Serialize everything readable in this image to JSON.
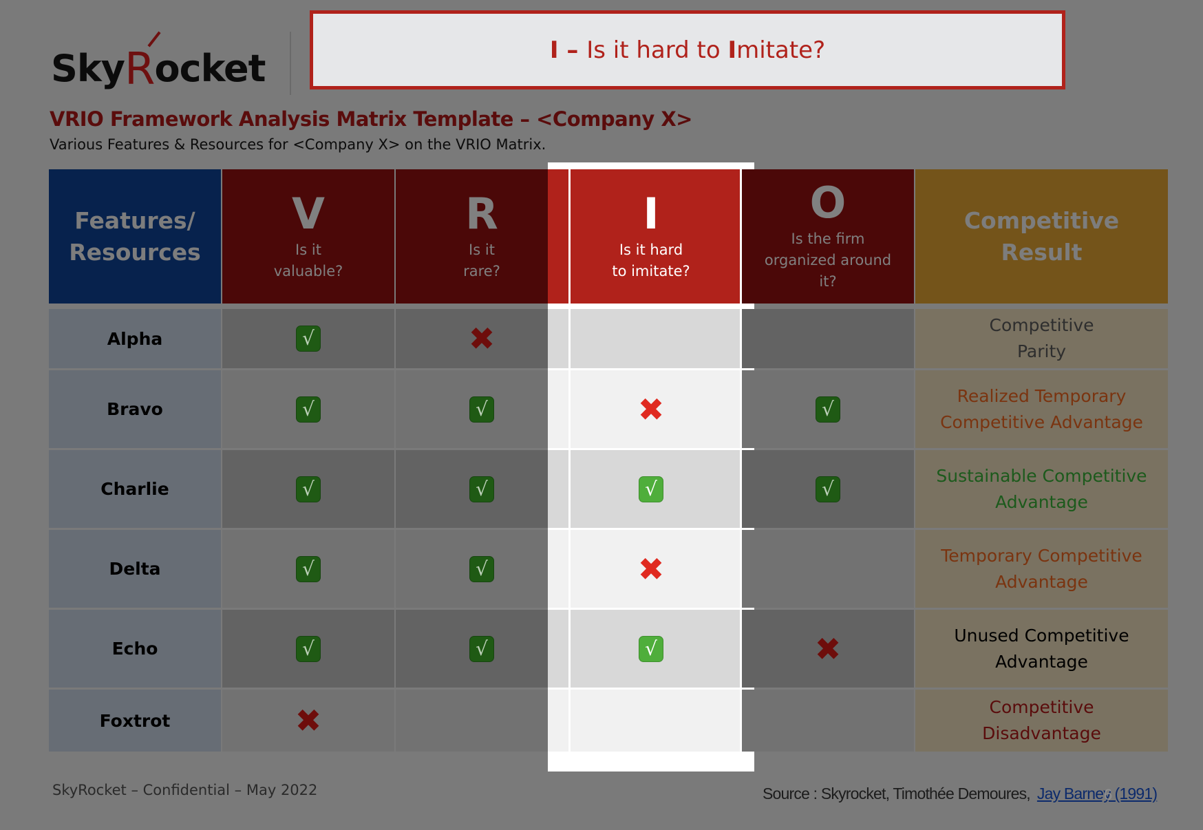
{
  "logo": {
    "prefix": "Sky",
    "accent": "R",
    "suffix": "ocket"
  },
  "title_box": {
    "letter": "I",
    "dash": " – ",
    "pre": "Is it hard to ",
    "accent": "I",
    "post": "mitate?"
  },
  "heading": "VRIO Framework Analysis Matrix Template – <Company X>",
  "subheading": "Various Features & Resources for <Company X> on the VRIO Matrix.",
  "colors": {
    "accent_red": "#b0221b",
    "dark_red": "#4b0808",
    "navy": "#07224d",
    "gold": "#74541a",
    "check_green": "#1f5a14",
    "check_green_bright": "#4fae3b",
    "cross_red": "#6e0d0b",
    "cross_red_bright": "#e02a20"
  },
  "table": {
    "header": {
      "features_line1": "Features/",
      "features_line2": "Resources",
      "columns": [
        {
          "letter": "V",
          "q1": "Is it",
          "q2": "valuable?",
          "q3": ""
        },
        {
          "letter": "R",
          "q1": "Is it",
          "q2": "rare?",
          "q3": ""
        },
        {
          "letter": "I",
          "q1": "Is it hard",
          "q2": "to imitate?",
          "q3": ""
        },
        {
          "letter": "O",
          "q1": "Is the firm",
          "q2": "organized around",
          "q3": "it?"
        }
      ],
      "result_line1": "Competitive",
      "result_line2": "Result"
    },
    "highlighted_column": "I",
    "rows": [
      {
        "name": "Alpha",
        "v": "check",
        "r": "cross",
        "i": "",
        "o": "",
        "result_line1": "Competitive",
        "result_line2": "Parity",
        "result_color": "#2e2e2e"
      },
      {
        "name": "Bravo",
        "v": "check",
        "r": "check",
        "i": "cross",
        "o": "check",
        "result_line1": "Realized Temporary",
        "result_line2": "Competitive Advantage",
        "result_color": "#7a3410"
      },
      {
        "name": "Charlie",
        "v": "check",
        "r": "check",
        "i": "check",
        "o": "check",
        "result_line1": "Sustainable Competitive",
        "result_line2": "Advantage",
        "result_color": "#1c5a1c"
      },
      {
        "name": "Delta",
        "v": "check",
        "r": "check",
        "i": "cross",
        "o": "",
        "result_line1": "Temporary Competitive",
        "result_line2": "Advantage",
        "result_color": "#7a3410"
      },
      {
        "name": "Echo",
        "v": "check",
        "r": "check",
        "i": "check",
        "o": "cross",
        "result_line1": "Unused Competitive",
        "result_line2": "Advantage",
        "result_color": "#000000"
      },
      {
        "name": "Foxtrot",
        "v": "cross",
        "r": "",
        "i": "",
        "o": "",
        "result_line1": "Competitive",
        "result_line2": "Disadvantage",
        "result_color": "#5a0c0c"
      }
    ]
  },
  "footer": {
    "left": "SkyRocket – Confidential – May 2022",
    "source_prefix": "Source : Skyrocket, Timothée Demoures,",
    "source_link": "Jay Barney (1991)",
    "page_number": "6"
  }
}
